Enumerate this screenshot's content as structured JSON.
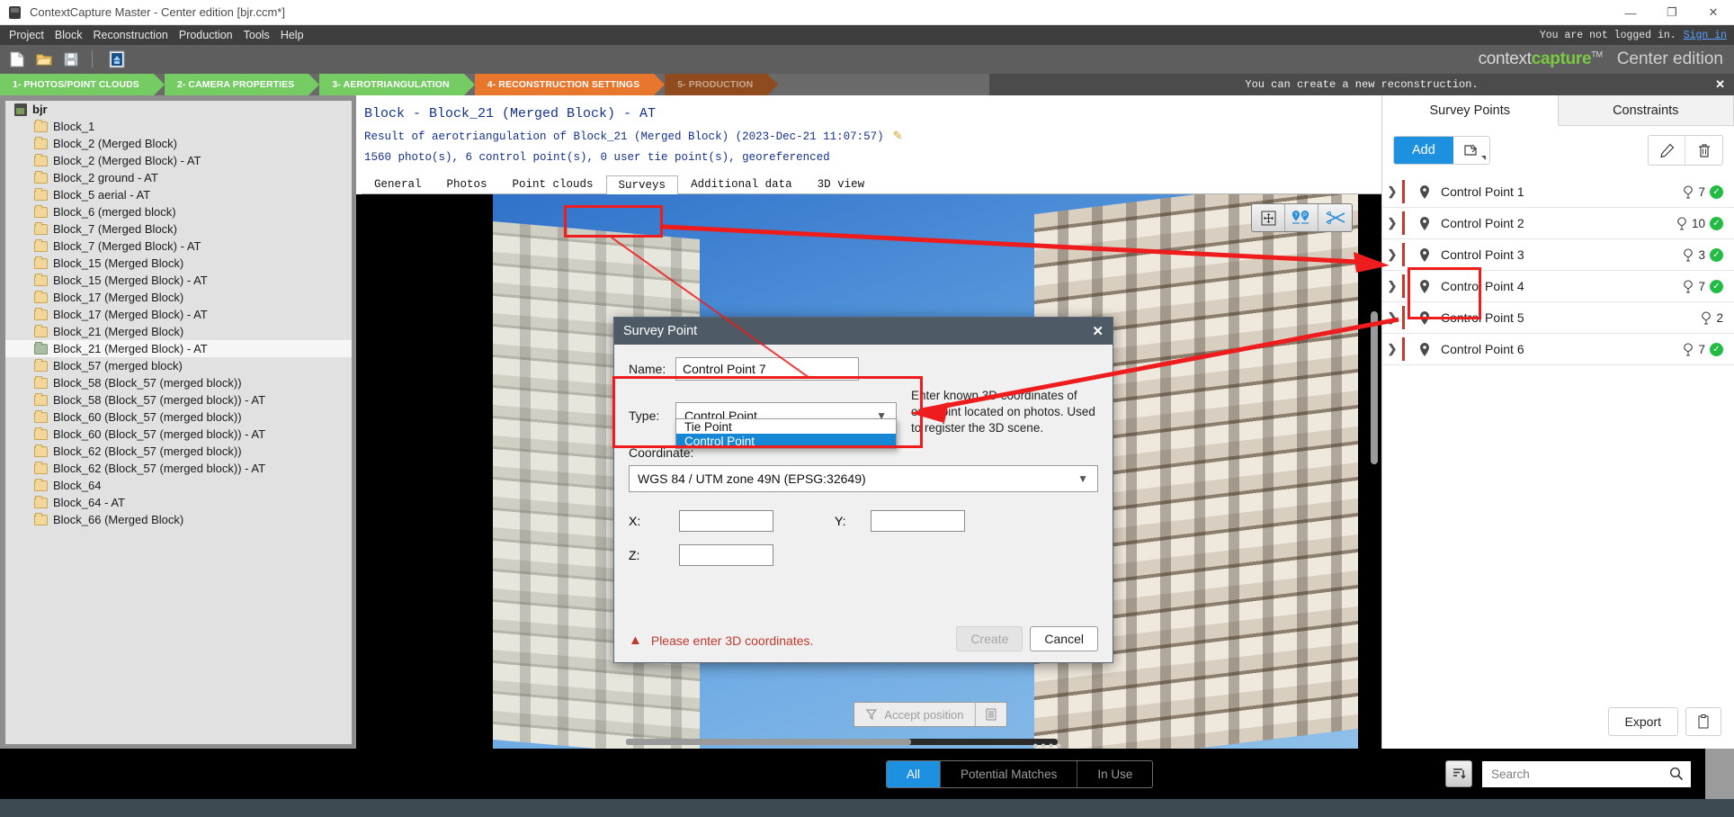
{
  "window": {
    "title": "ContextCapture Master - Center edition [bjr.ccm*]",
    "minimize": "—",
    "maximize": "❐",
    "close": "✕"
  },
  "menu": {
    "items": [
      "Project",
      "Block",
      "Reconstruction",
      "Production",
      "Tools",
      "Help"
    ],
    "login_text": "You are not logged in.",
    "login_link": "Sign in"
  },
  "toolbar": {
    "icons": [
      "new-document-icon",
      "open-folder-icon",
      "save-disk-icon",
      "import-block-icon"
    ],
    "brand_main": "contextcapture",
    "brand_tm": "TM",
    "brand_edition": "Center edition"
  },
  "workflow": {
    "steps": [
      {
        "label": "1- PHOTOS/POINT CLOUDS",
        "state": "done"
      },
      {
        "label": "2- CAMERA PROPERTIES",
        "state": "done"
      },
      {
        "label": "3- AEROTRIANGULATION",
        "state": "done"
      },
      {
        "label": "4- RECONSTRUCTION SETTINGS",
        "state": "current"
      },
      {
        "label": "5- PRODUCTION",
        "state": "disabled"
      }
    ],
    "notification": "You can create a new reconstruction.",
    "notification_close": "✕"
  },
  "tree": {
    "root": "bjr",
    "items": [
      {
        "label": "Block_1",
        "selected": false
      },
      {
        "label": "Block_2 (Merged Block)",
        "selected": false
      },
      {
        "label": "Block_2 (Merged Block) - AT",
        "selected": false
      },
      {
        "label": "Block_2 ground - AT",
        "selected": false
      },
      {
        "label": "Block_5 aerial - AT",
        "selected": false
      },
      {
        "label": "Block_6 (merged block)",
        "selected": false
      },
      {
        "label": "Block_7 (Merged Block)",
        "selected": false
      },
      {
        "label": "Block_7 (Merged Block) - AT",
        "selected": false
      },
      {
        "label": "Block_15 (Merged Block)",
        "selected": false
      },
      {
        "label": "Block_15 (Merged Block) - AT",
        "selected": false
      },
      {
        "label": "Block_17 (Merged Block)",
        "selected": false
      },
      {
        "label": "Block_17 (Merged Block) - AT",
        "selected": false
      },
      {
        "label": "Block_21 (Merged Block)",
        "selected": false
      },
      {
        "label": "Block_21 (Merged Block) - AT",
        "selected": true
      },
      {
        "label": "Block_57 (merged block)",
        "selected": false
      },
      {
        "label": "Block_58 (Block_57 (merged block))",
        "selected": false
      },
      {
        "label": "Block_58 (Block_57 (merged block)) - AT",
        "selected": false
      },
      {
        "label": "Block_60 (Block_57 (merged block))",
        "selected": false
      },
      {
        "label": "Block_60 (Block_57 (merged block)) - AT",
        "selected": false
      },
      {
        "label": "Block_62 (Block_57 (merged block))",
        "selected": false
      },
      {
        "label": "Block_62 (Block_57 (merged block)) - AT",
        "selected": false
      },
      {
        "label": "Block_64",
        "selected": false
      },
      {
        "label": "Block_64 - AT",
        "selected": false
      },
      {
        "label": "Block_66 (Merged Block)",
        "selected": false
      }
    ]
  },
  "block": {
    "title": "Block - Block_21 (Merged Block) - AT",
    "subtitle": "Result of aerotriangulation of Block_21 (Merged Block) (2023-Dec-21 11:07:57)",
    "stats": "1560 photo(s), 6 control point(s), 0 user tie point(s), georeferenced",
    "tabs": [
      {
        "label": "General",
        "active": false
      },
      {
        "label": "Photos",
        "active": false
      },
      {
        "label": "Point clouds",
        "active": false
      },
      {
        "label": "Surveys",
        "active": true
      },
      {
        "label": "Additional data",
        "active": false
      },
      {
        "label": "3D view",
        "active": false
      }
    ]
  },
  "viewer": {
    "tools": [
      "pan-move-icon",
      "measure-points-icon",
      "cut-scissors-icon"
    ],
    "accept_label": "Accept position",
    "accept_icon": "accept-marker-icon",
    "delete_icon": "trash-bars-icon"
  },
  "dialog": {
    "title": "Survey Point",
    "close": "✕",
    "name_label": "Name:",
    "name_value": "Control Point 7",
    "type_label": "Type:",
    "type_value": "Control Point",
    "type_options": [
      {
        "label": "Tie Point",
        "selected": false
      },
      {
        "label": "Control Point",
        "selected": true
      }
    ],
    "hint": "Enter known 3D coordinates of one point located on photos. Used to register the 3D scene.",
    "coordinate_label": "Coordinate:",
    "srs_value": "WGS 84 / UTM zone 49N (EPSG:32649)",
    "x_label": "X:",
    "x_value": "",
    "y_label": "Y:",
    "y_value": "",
    "z_label": "Z:",
    "z_value": "",
    "error": "Please enter 3D coordinates.",
    "create_label": "Create",
    "cancel_label": "Cancel"
  },
  "survey_panel": {
    "tabs": [
      {
        "label": "Survey Points",
        "active": true
      },
      {
        "label": "Constraints",
        "active": false
      }
    ],
    "add_label": "Add",
    "import_icon": "import-points-icon",
    "edit_icon": "pencil-icon",
    "delete_icon": "trash-icon",
    "points": [
      {
        "name": "Control Point 1",
        "count": "7",
        "verified": true
      },
      {
        "name": "Control Point 2",
        "count": "10",
        "verified": true
      },
      {
        "name": "Control Point 3",
        "count": "3",
        "verified": true
      },
      {
        "name": "Control Point 4",
        "count": "7",
        "verified": true
      },
      {
        "name": "Control Point 5",
        "count": "2",
        "verified": false
      },
      {
        "name": "Control Point 6",
        "count": "7",
        "verified": true
      }
    ],
    "export_label": "Export",
    "copy_icon": "clipboard-icon"
  },
  "bottom": {
    "filters": [
      {
        "label": "All",
        "active": true
      },
      {
        "label": "Potential Matches",
        "active": false
      },
      {
        "label": "In Use",
        "active": false
      }
    ],
    "sort_icon": "sort-list-icon",
    "search_placeholder": "Search",
    "search_value": "",
    "search_icon": "search-icon"
  },
  "colors": {
    "accent_blue": "#1e90e0",
    "step_green": "#74cc63",
    "step_orange": "#e8762c",
    "annotation_red": "#ee1c1c",
    "error_red": "#c0392b"
  }
}
